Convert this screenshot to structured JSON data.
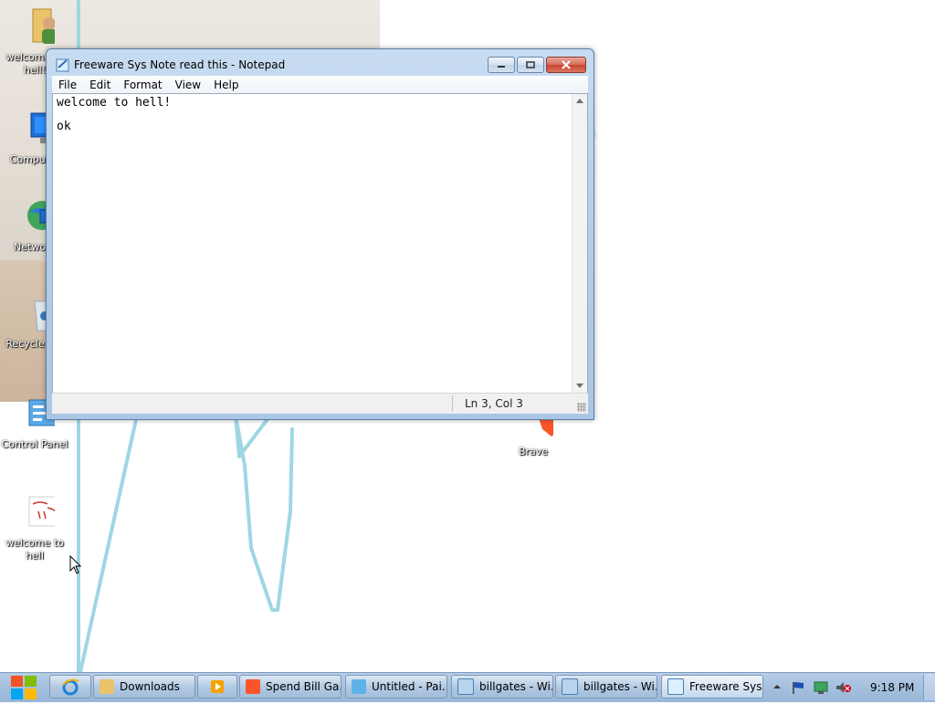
{
  "desktop": {
    "icons": [
      {
        "label": "welcome to hell!",
        "icon": "user-folder-icon"
      },
      {
        "label": "Computer",
        "icon": "computer-icon"
      },
      {
        "label": "Network",
        "icon": "network-icon"
      },
      {
        "label": "Recycle Bin",
        "icon": "recycle-bin-icon"
      },
      {
        "label": "Control Panel",
        "icon": "control-panel-icon"
      },
      {
        "label": "welcome to hell",
        "icon": "image-file-icon"
      },
      {
        "label": "Brave",
        "icon": "brave-icon"
      }
    ]
  },
  "notepad": {
    "title": "Freeware Sys Note read this - Notepad",
    "menu": [
      "File",
      "Edit",
      "Format",
      "View",
      "Help"
    ],
    "content": "welcome to hell!\n\nok",
    "status": "Ln 3, Col 3"
  },
  "taskbar": {
    "items": [
      {
        "label": "",
        "icon": "internet-explorer-icon"
      },
      {
        "label": "Downloads",
        "icon": "folder-icon"
      },
      {
        "label": "",
        "icon": "media-player-icon"
      },
      {
        "label": "Spend Bill Ga...",
        "icon": "brave-icon"
      },
      {
        "label": "Untitled - Pai...",
        "icon": "paint-icon"
      },
      {
        "label": "billgates - Wi...",
        "icon": "image-viewer-icon"
      },
      {
        "label": "billgates - Wi...",
        "icon": "image-viewer-icon"
      },
      {
        "label": "Freeware Sys...",
        "icon": "notepad-icon"
      }
    ],
    "clock": "9:18 PM"
  },
  "colors": {
    "taskbar": "#a6c1df",
    "window_frame": "#b7d0ea",
    "wallpaper_line": "#8ecfe0"
  }
}
